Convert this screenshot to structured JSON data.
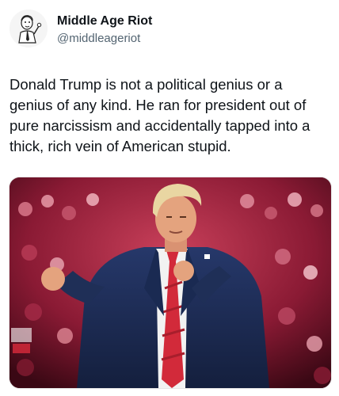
{
  "author": {
    "display_name": "Middle Age Riot",
    "handle": "@middleageriot",
    "avatar_icon": "cartoon-man-avatar-icon"
  },
  "tweet": {
    "text": "Donald Trump is not a political genius or a genius of any kind. He ran for president out of pure narcissism and accidentally tapped into a thick, rich vein of American stupid."
  },
  "media": {
    "description_icon": "rally-photo",
    "colors": {
      "crowd": "#b3203e",
      "suit": "#1f2f57",
      "tie": "#d22a3a",
      "shirt": "#f2f2f2",
      "skin": "#e4a37e",
      "hair": "#e9d6a2"
    }
  }
}
